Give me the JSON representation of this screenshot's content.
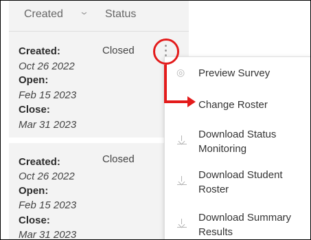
{
  "table": {
    "header": {
      "created_label": "Created",
      "sort_icon": "chevron-down-icon",
      "status_label": "Status"
    },
    "rows": [
      {
        "created_label": "Created:",
        "created_date": "Oct 26 2022",
        "open_label": "Open:",
        "open_date": "Feb 15 2023",
        "close_label": "Close:",
        "close_date": "Mar 31 2023",
        "status": "Closed"
      },
      {
        "created_label": "Created:",
        "created_date": "Oct 26 2022",
        "open_label": "Open:",
        "open_date": "Feb 15 2023",
        "close_label": "Close:",
        "close_date": "Mar 31 2023",
        "status": "Closed"
      }
    ]
  },
  "actions_menu": {
    "trigger_icon": "more-vertical-icon",
    "items": [
      {
        "label": "Preview Survey",
        "icon": "eye-icon"
      },
      {
        "label": "Change Roster",
        "icon": ""
      },
      {
        "label": "Download Status Monitoring",
        "icon": "download-icon"
      },
      {
        "label": "Download Student Roster",
        "icon": "download-icon"
      },
      {
        "label": "Download Summary Results",
        "icon": "download-icon"
      }
    ]
  },
  "annotation": {
    "color": "#e31b1b",
    "highlight_shape": "circle-around-menu-trigger",
    "arrow_target": "Change Roster"
  },
  "colors": {
    "row_background": "#f3f3f3",
    "icon_gray": "#b5b5b5",
    "text_dark": "#333333"
  }
}
